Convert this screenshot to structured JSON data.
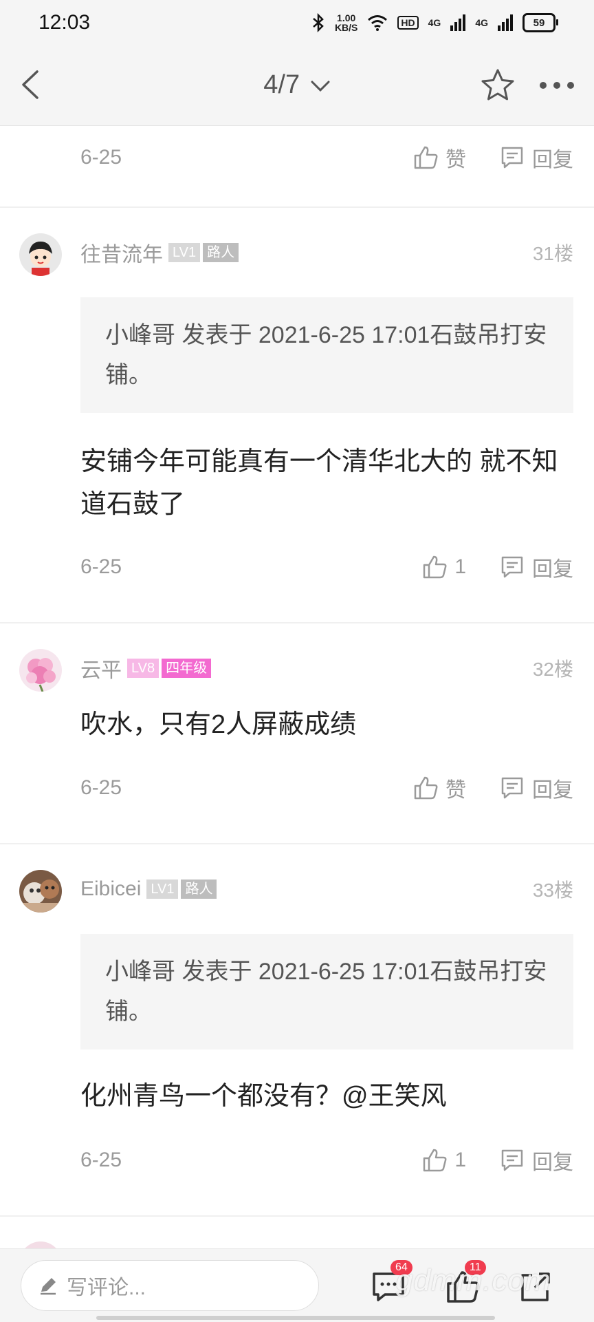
{
  "status_bar": {
    "time": "12:03",
    "net_speed_value": "1.00",
    "net_speed_unit": "KB/S",
    "hd_label": "HD",
    "signal1_label": "4G",
    "signal2_label": "4G",
    "battery_level": "59"
  },
  "top_bar": {
    "page_indicator": "4/7",
    "icons": [
      "back-arrow",
      "chevron-down",
      "star",
      "more-dots"
    ]
  },
  "colors": {
    "badge_grey": "#d8d8d8",
    "badge_pink": "#f7b8e6",
    "badge_pink_title": "#f36ad0",
    "notification_red": "#f03c4f"
  },
  "prev_post": {
    "date": "6-25",
    "like_label": "赞",
    "reply_label": "回复"
  },
  "posts": [
    {
      "username": "往昔流年",
      "level": "LV1",
      "title": "路人",
      "floor": "31楼",
      "quote": "小峰哥 发表于 2021-6-25 17:01石鼓吊打安铺。",
      "content": "安铺今年可能真有一个清华北大的   就不知道石鼓了",
      "date": "6-25",
      "like_label": "1",
      "reply_label": "回复"
    },
    {
      "username": "云平",
      "level": "LV8",
      "title": "四年级",
      "floor": "32楼",
      "content": "吹水，只有2人屏蔽成绩",
      "date": "6-25",
      "like_label": "赞",
      "reply_label": "回复"
    },
    {
      "username": "Eibicei",
      "level": "LV1",
      "title": "路人",
      "floor": "33楼",
      "quote": "小峰哥 发表于 2021-6-25 17:01石鼓吊打安铺。",
      "content": "化州青鸟一个都没有？@王笑风",
      "date": "6-25",
      "like_label": "1",
      "reply_label": "回复"
    }
  ],
  "bottom_bar": {
    "comment_placeholder": "写评论...",
    "comments_badge": "64",
    "likes_badge": "11"
  },
  "watermark": "gdmm.com"
}
